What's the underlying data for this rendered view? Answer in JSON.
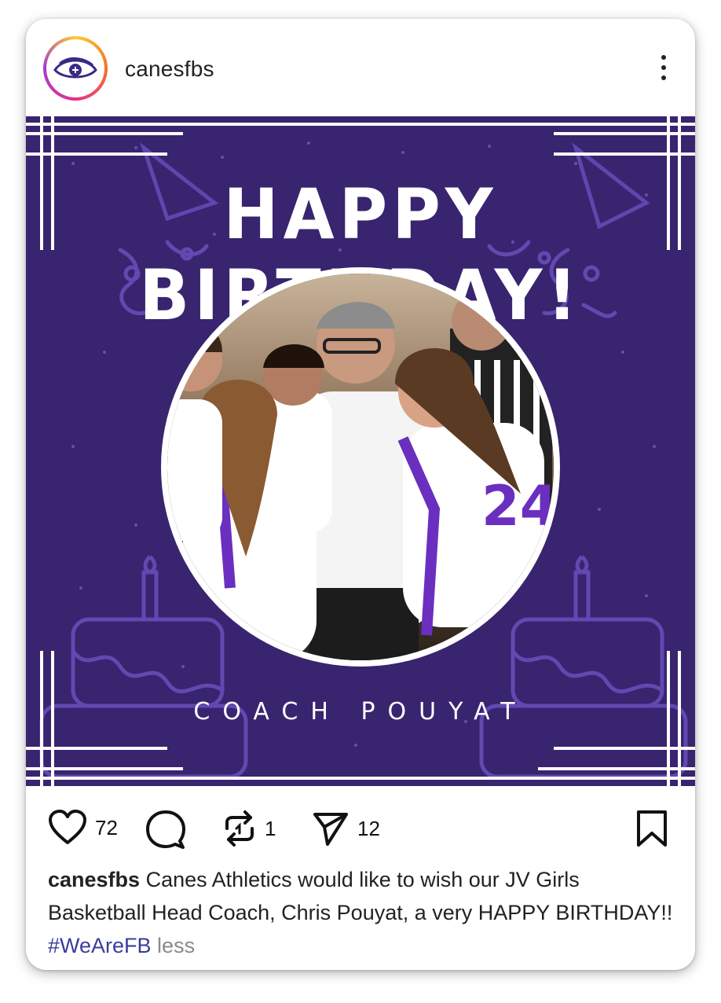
{
  "post": {
    "username": "canesfbs",
    "image": {
      "title": "HAPPY BIRTHDAY!",
      "subtitle": "COACH POUYAT",
      "jersey_number": "24",
      "background_color": "#38246f"
    },
    "actions": {
      "likes": "72",
      "reposts": "1",
      "shares": "12"
    },
    "caption": {
      "username": "canesfbs",
      "text": " Canes Athletics would like to wish our JV Girls Basketball Head Coach, Chris Pouyat, a very HAPPY BIRTHDAY!! ",
      "hashtag": "#WeAreFB",
      "less_label": " less"
    }
  },
  "icons": {
    "more": "more-options-icon",
    "like": "heart-icon",
    "comment": "comment-icon",
    "repost": "repost-icon",
    "share": "send-icon",
    "save": "bookmark-icon"
  }
}
